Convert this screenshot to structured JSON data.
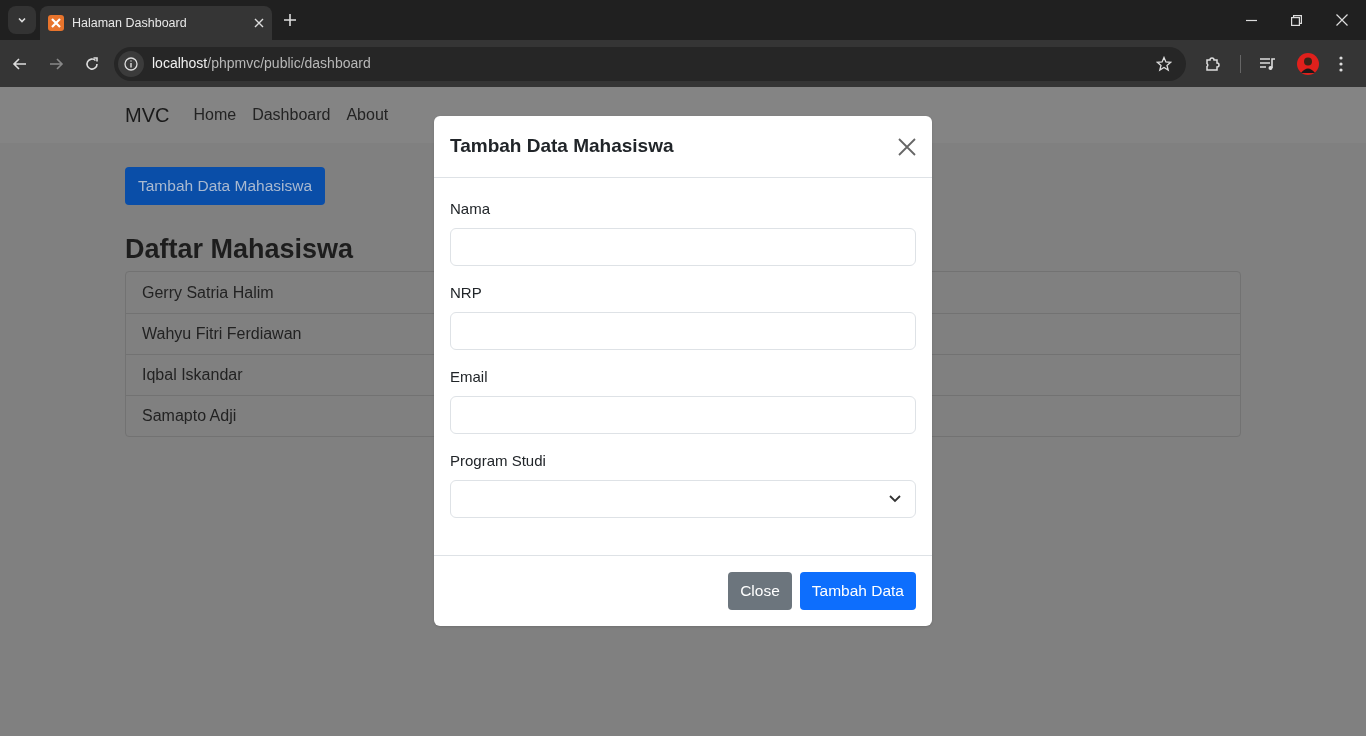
{
  "browser": {
    "tab_title": "Halaman Dashboard",
    "address": "localhost/phpmvc/public/dashboard"
  },
  "navbar": {
    "brand": "MVC",
    "links": [
      {
        "label": "Home"
      },
      {
        "label": "Dashboard"
      },
      {
        "label": "About"
      }
    ]
  },
  "add_button": "Tambah Data Mahasiswa",
  "list": {
    "title": "Daftar Mahasiswa",
    "items": [
      "Gerry Satria Halim",
      "Wahyu Fitri Ferdiawan",
      "Iqbal Iskandar",
      "Samapto Adji"
    ]
  },
  "modal": {
    "title": "Tambah Data Mahasiswa",
    "fields": [
      {
        "label": "Nama",
        "kind": "text"
      },
      {
        "label": "NRP",
        "kind": "text"
      },
      {
        "label": "Email",
        "kind": "text"
      },
      {
        "label": "Program Studi",
        "kind": "select"
      }
    ],
    "buttons": [
      {
        "label": "Close",
        "kind": "secondary"
      },
      {
        "label": "Tambah Data",
        "kind": "primary"
      }
    ]
  }
}
